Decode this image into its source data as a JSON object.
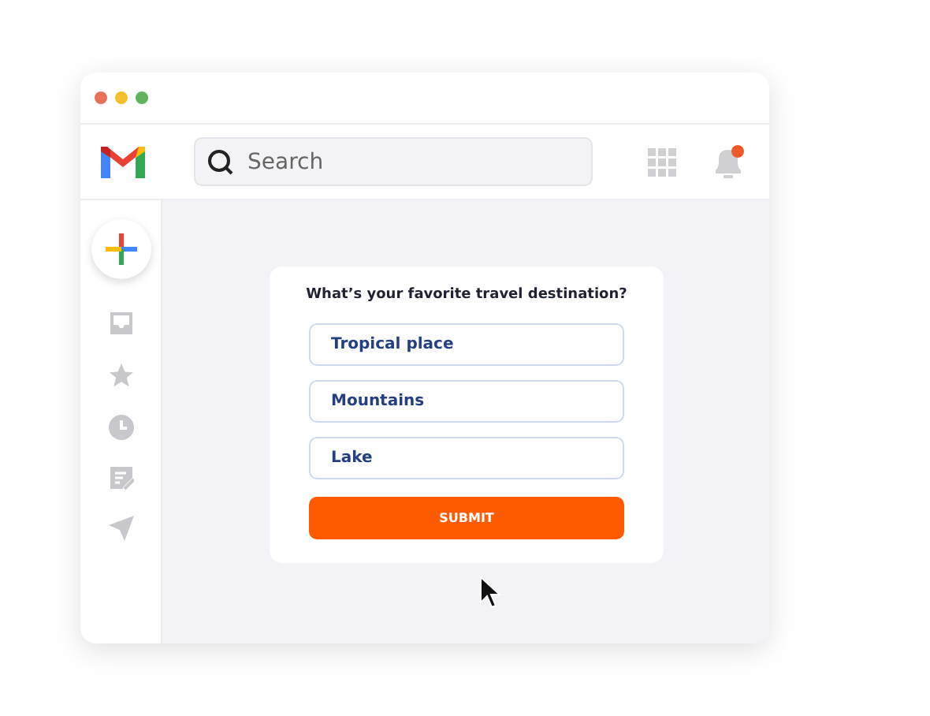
{
  "search": {
    "placeholder": "Search"
  },
  "notifications": {
    "unread": true
  },
  "poll": {
    "question": "What’s your favorite travel destination?",
    "options": [
      "Tropical place",
      "Mountains",
      "Lake"
    ],
    "submit": "SUBMIT"
  }
}
